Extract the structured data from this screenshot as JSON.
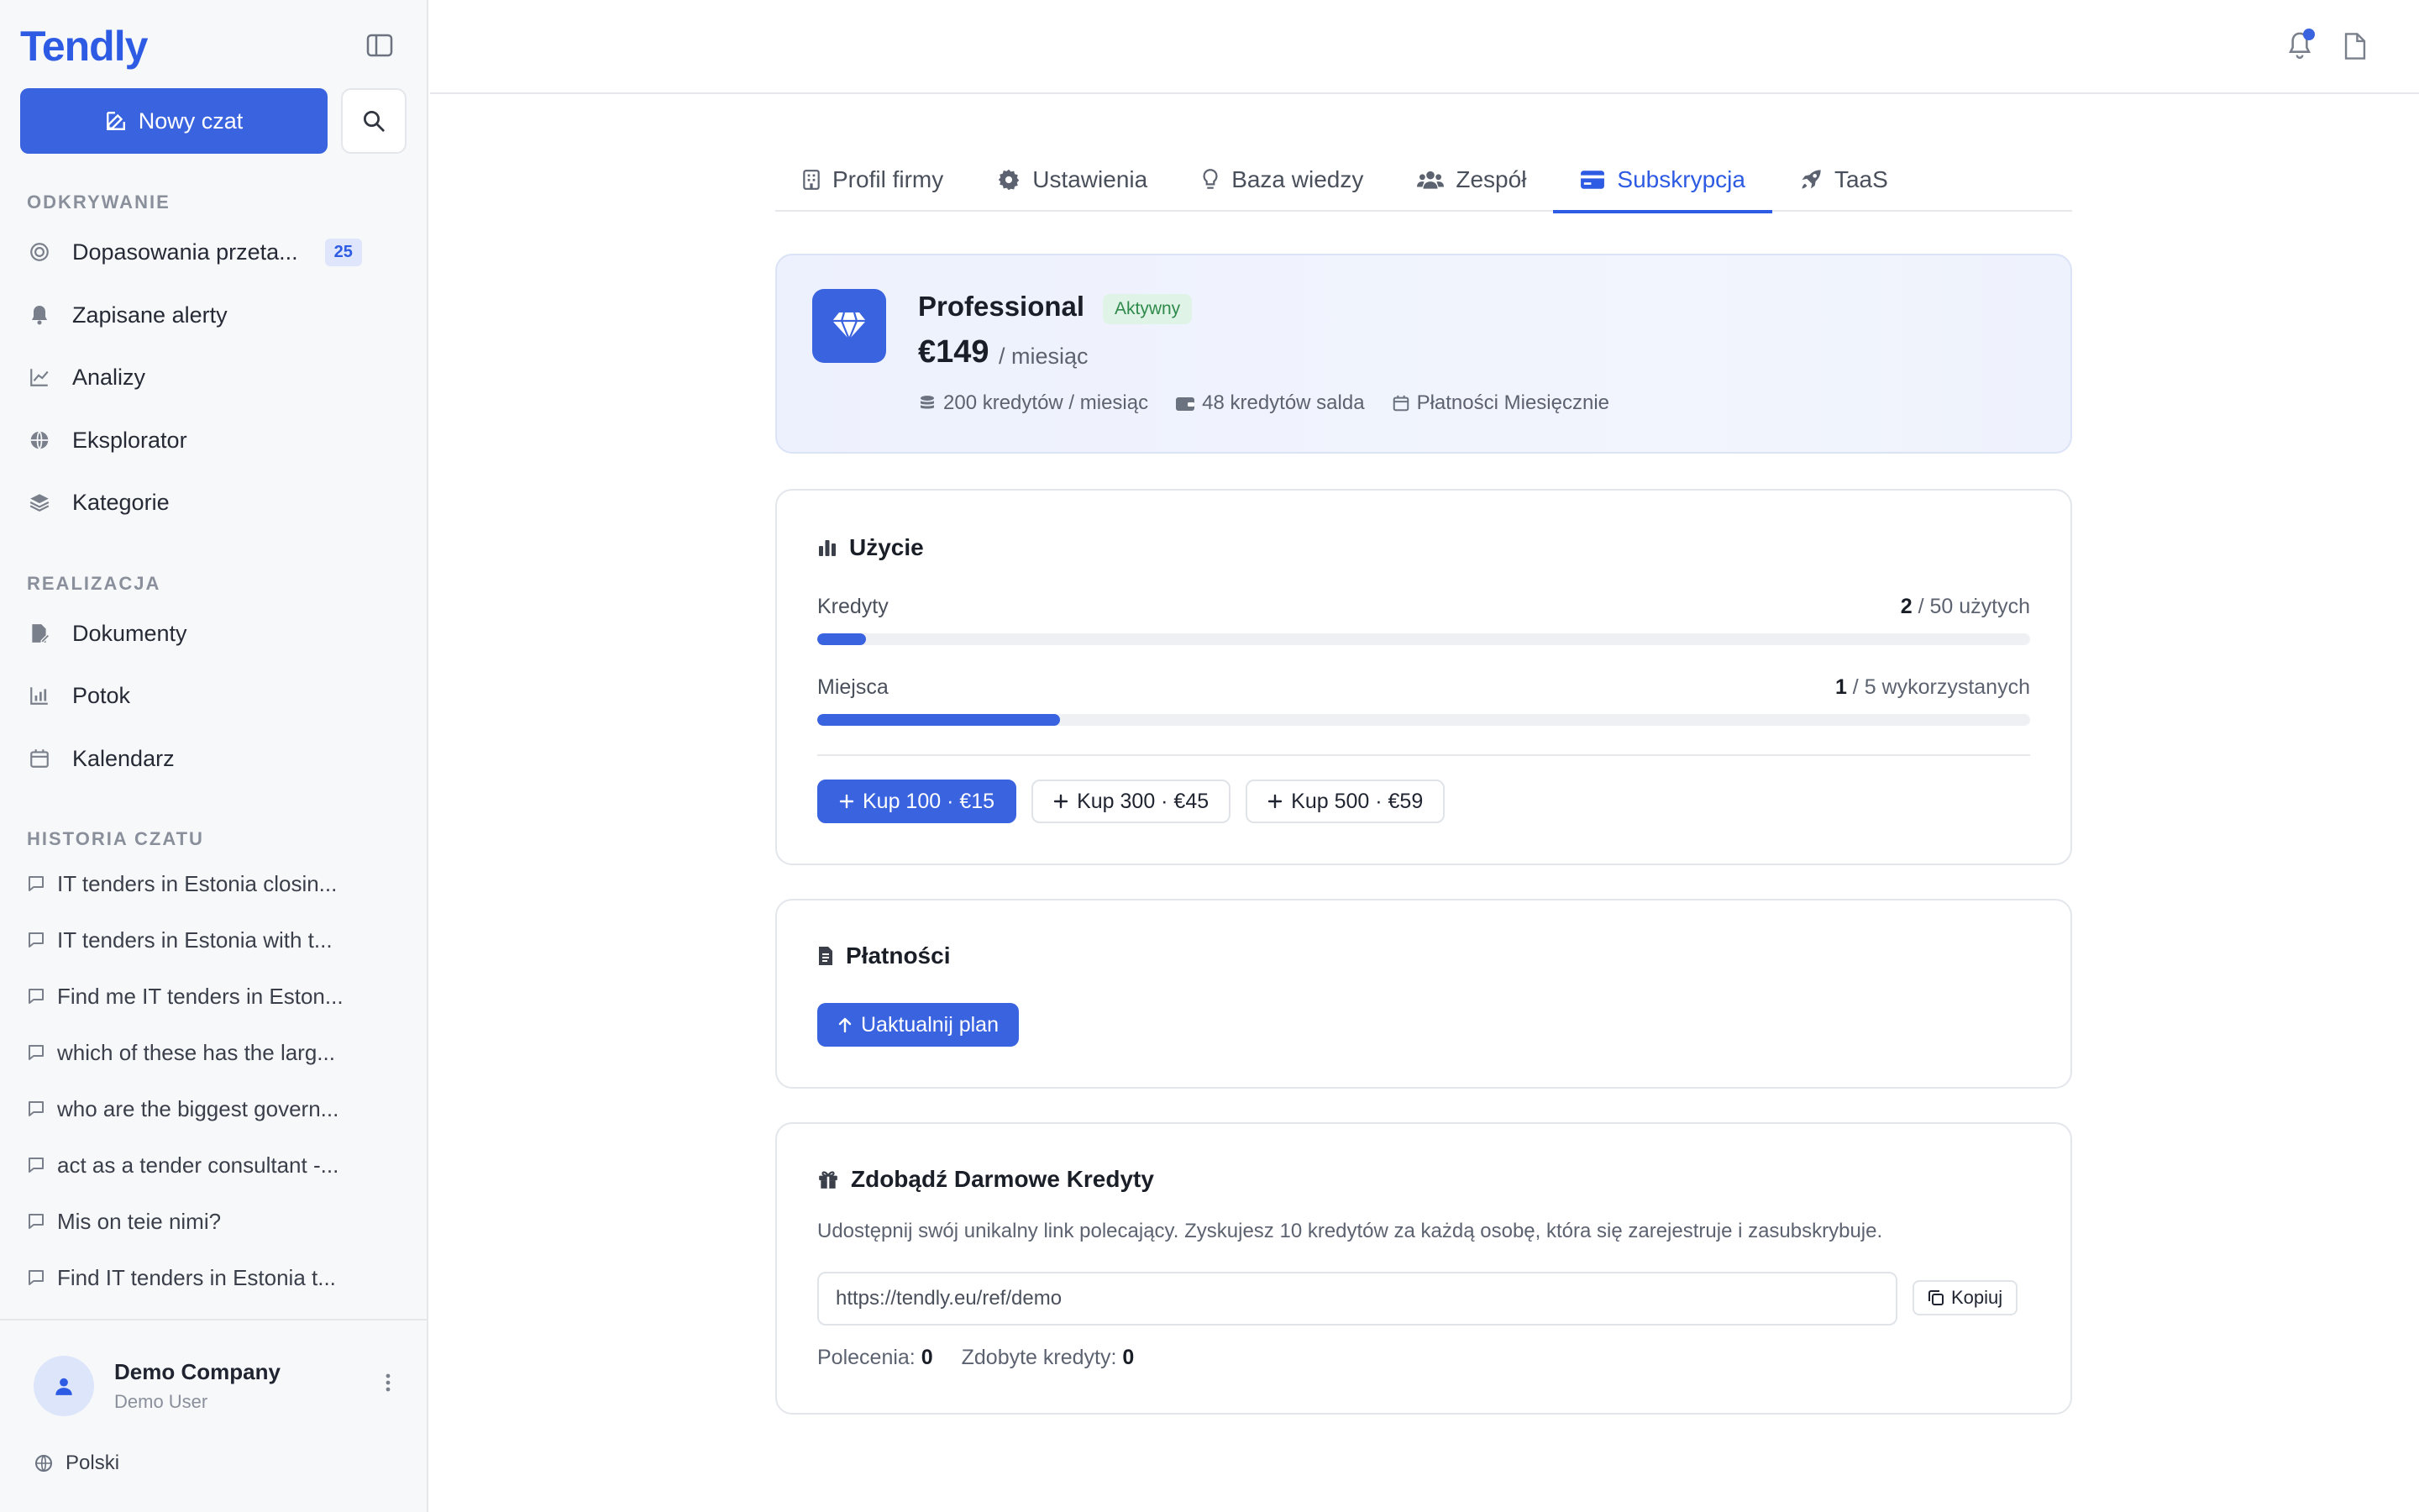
{
  "brand": {
    "logo": "Tendly",
    "accent": "#3a63e0"
  },
  "sidebar": {
    "new_chat_label": "Nowy czat",
    "discover_title": "ODKRYWANIE",
    "discover_items": [
      {
        "label": "Dopasowania przeta...",
        "badge": "25",
        "icon": "target-icon"
      },
      {
        "label": "Zapisane alerty",
        "icon": "bell-icon"
      },
      {
        "label": "Analizy",
        "icon": "chart-line-icon"
      },
      {
        "label": "Eksplorator",
        "icon": "globe-icon"
      },
      {
        "label": "Kategorie",
        "icon": "layers-icon"
      }
    ],
    "execute_title": "REALIZACJA",
    "execute_items": [
      {
        "label": "Dokumenty",
        "icon": "file-edit-icon"
      },
      {
        "label": "Potok",
        "icon": "bar-chart-icon"
      },
      {
        "label": "Kalendarz",
        "icon": "calendar-icon"
      }
    ],
    "history_title": "HISTORIA CZATU",
    "history": [
      "IT tenders in Estonia closin...",
      "IT tenders in Estonia with t...",
      "Find me IT tenders in Eston...",
      "which of these has the larg...",
      "who are the biggest govern...",
      "act as a tender consultant -...",
      "Mis on teie nimi?",
      "Find IT tenders in Estonia t..."
    ],
    "user": {
      "company": "Demo Company",
      "role": "Demo User"
    },
    "language": "Polski"
  },
  "tabs": [
    {
      "label": "Profil firmy",
      "icon": "building-icon"
    },
    {
      "label": "Ustawienia",
      "icon": "gear-icon"
    },
    {
      "label": "Baza wiedzy",
      "icon": "lightbulb-icon"
    },
    {
      "label": "Zespół",
      "icon": "users-icon"
    },
    {
      "label": "Subskrypcja",
      "icon": "credit-card-icon",
      "active": true
    },
    {
      "label": "TaaS",
      "icon": "rocket-icon"
    }
  ],
  "plan": {
    "name": "Professional",
    "status": "Aktywny",
    "price": "€149",
    "price_unit": "/ miesiąc",
    "meta": {
      "credits_per_month": "200 kredytów / miesiąc",
      "balance": "48 kredytów salda",
      "billing": "Płatności Miesięcznie"
    }
  },
  "usage": {
    "title": "Użycie",
    "credits": {
      "label": "Kredyty",
      "used": "2",
      "rest": " / 50 użytych",
      "fraction": 0.04
    },
    "seats": {
      "label": "Miejsca",
      "used": "1",
      "rest": " / 5 wykorzystanych",
      "fraction": 0.2
    },
    "buy": [
      "Kup 100 · €15",
      "Kup 300 · €45",
      "Kup 500 · €59"
    ]
  },
  "payments": {
    "title": "Płatności",
    "upgrade_label": "Uaktualnij plan"
  },
  "referral": {
    "title": "Zdobądź Darmowe Kredyty",
    "description": "Udostępnij swój unikalny link polecający. Zyskujesz 10 kredytów za każdą osobę, która się zarejestruje i zasubskrybuje.",
    "link": "https://tendly.eu/ref/demo",
    "copy_label": "Kopiuj",
    "referrals_label": "Polecenia:",
    "referrals_value": "0",
    "earned_label": "Zdobyte kredyty:",
    "earned_value": "0"
  }
}
